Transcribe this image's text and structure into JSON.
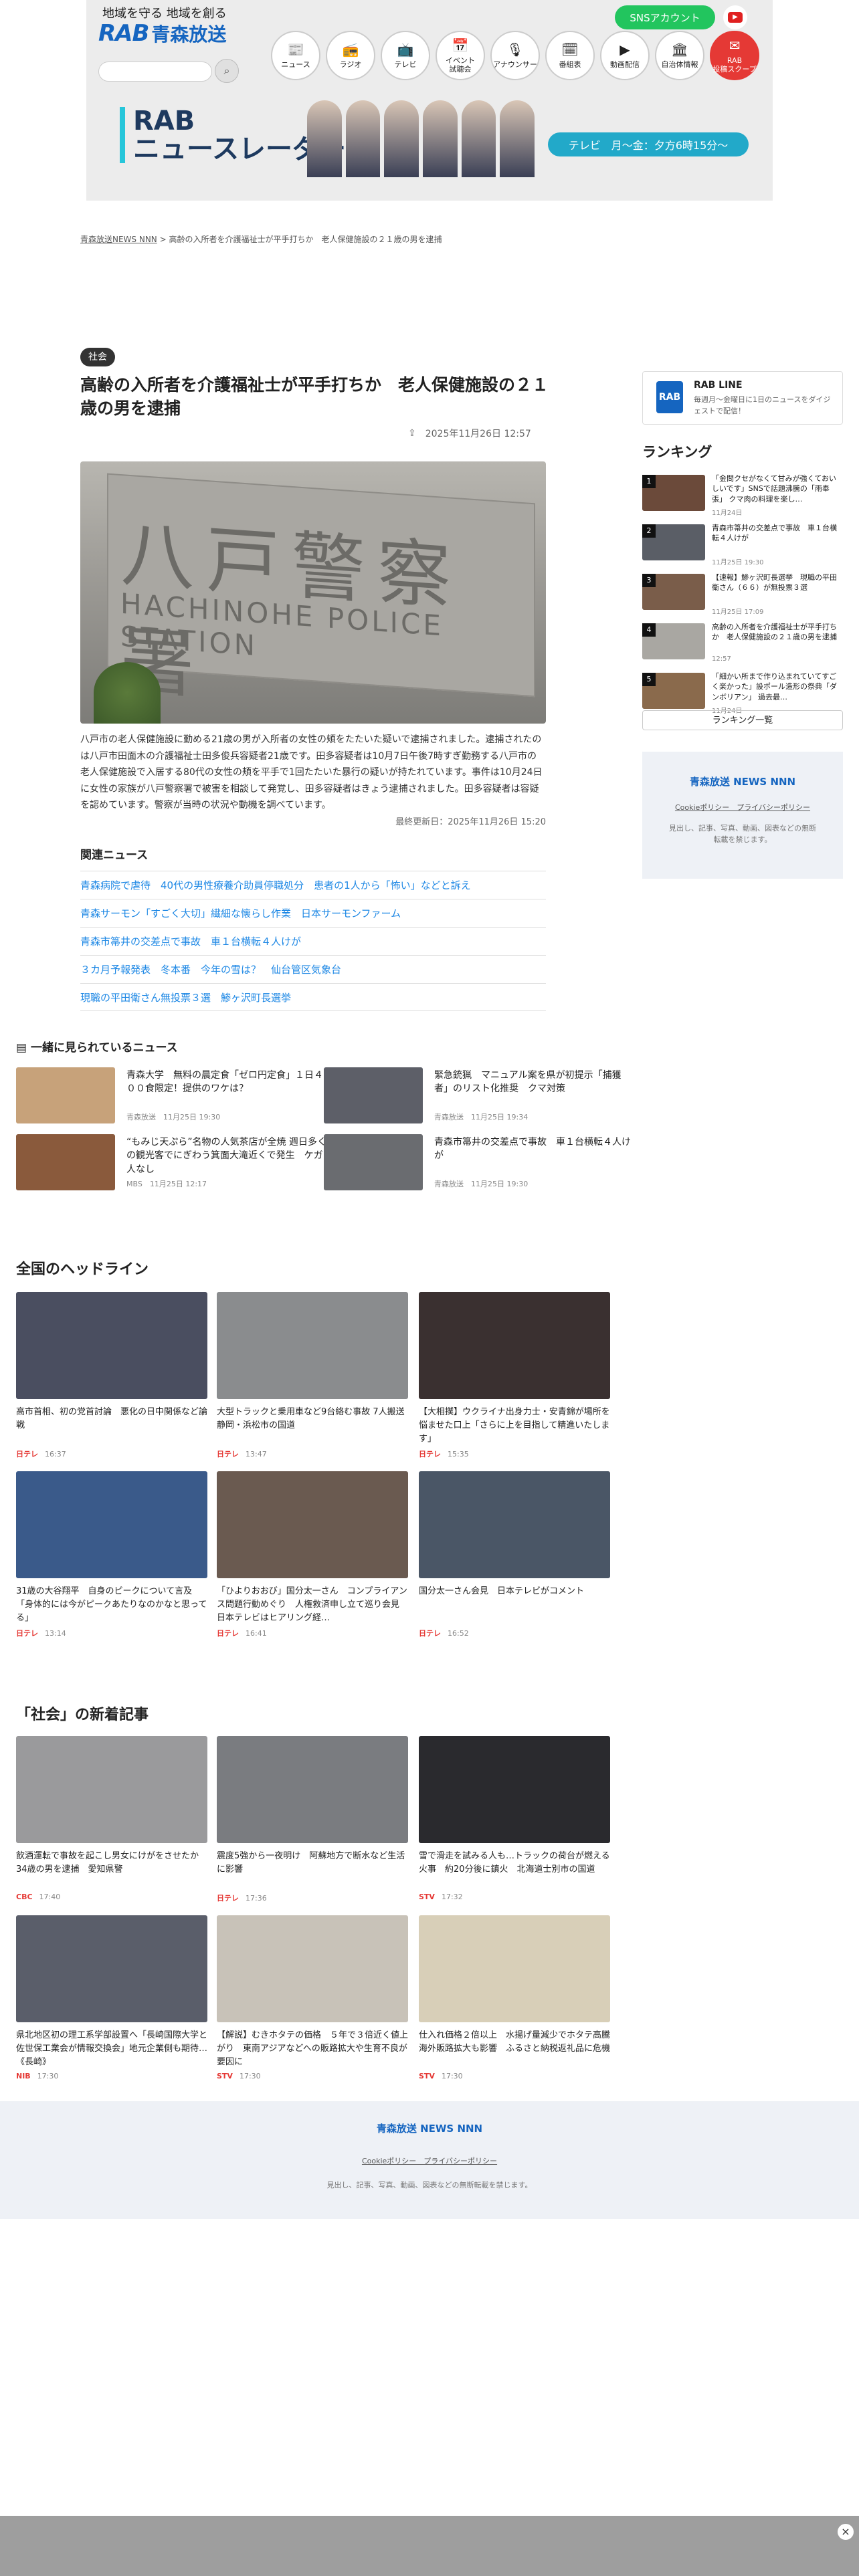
{
  "header": {
    "tagline": "地域を守る 地域を創る",
    "logo_latin": "RAB",
    "logo_kanji": "青森放送",
    "sns_label": "SNSアカウント",
    "youtube_icon": "youtube-icon",
    "nav": [
      {
        "icon": "📰",
        "label": "ニュース"
      },
      {
        "icon": "📻",
        "label": "ラジオ"
      },
      {
        "icon": "📺",
        "label": "テレビ"
      },
      {
        "icon": "📅",
        "label": "イベント\n試聴会"
      },
      {
        "icon": "🎙",
        "label": "アナウンサー"
      },
      {
        "icon": "🗓",
        "label": "番組表"
      },
      {
        "icon": "▶",
        "label": "動画配信"
      },
      {
        "icon": "🏛",
        "label": "自治体情報"
      },
      {
        "icon": "✉",
        "label": "RAB\n投稿スクープ"
      }
    ],
    "banner_title": "RAB\nニュースレーダー",
    "banner_schedule": "テレビ　月〜金：夕方6時15分〜"
  },
  "breadcrumb": {
    "root": "青森放送NEWS NNN",
    "sep": ">",
    "current": "高齢の入所者を介護福祉士が平手打ちか　老人保健施設の２１歳の男を逮捕"
  },
  "article": {
    "category": "社会",
    "title": "高齢の入所者を介護福祉士が平手打ちか　老人保健施設の２１歳の男を逮捕",
    "date": "2025年11月26日 12:57",
    "photo_text_ja": "八戸警察署",
    "photo_text_en": "HACHINOHE POLICE STATION",
    "body": "八戸市の老人保健施設に勤める21歳の男が入所者の女性の頬をたたいた疑いで逮捕されました。逮捕されたのは八戸市田面木の介護福祉士田多俊兵容疑者21歳です。田多容疑者は10月7日午後7時すぎ勤務する八戸市の老人保健施設で入居する80代の女性の頬を平手で1回たたいた暴行の疑いが持たれています。事件は10月24日に女性の家族が八戸警察署で被害を相談して発覚し、田多容疑者はきょう逮捕されました。田多容疑者は容疑を認めています。警察が当時の状況や動機を調べています。",
    "updated": "最終更新日：2025年11月26日 15:20",
    "related_heading": "関連ニュース",
    "related": [
      "青森病院で虐待　40代の男性療養介助員停職処分　患者の1人から「怖い」などと訴え",
      "青森サーモン「すごく大切」繊細な懐らし作業　日本サーモンファーム",
      "青森市箒井の交差点で事故　車１台横転４人けが",
      "３カ月予報発表　冬本番　今年の雪は？　仙台管区気象台",
      "現職の平田衛さん無投票３選　鯵ヶ沢町長選挙"
    ]
  },
  "sidebar": {
    "line_logo": "RAB",
    "line_title": "RAB LINE",
    "line_desc": "毎週月〜金曜日に1日のニュースをダイジェストで配信！",
    "ranking_heading": "ランキング",
    "ranking": [
      {
        "n": "1",
        "title": "「金問クセがなくて甘みが強くておいしいです」SNSで話題沸騰の「雨奉張」 クマ肉の料理を楽し…",
        "date": "11月24日"
      },
      {
        "n": "2",
        "title": "青森市箒井の交差点で事故　車１台横転４人けが",
        "date": "11月25日 19:30"
      },
      {
        "n": "3",
        "title": "【速報】鯵ヶ沢町長選挙　現職の平田衛さん（６６）が無投票３選",
        "date": "11月25日 17:09"
      },
      {
        "n": "4",
        "title": "高齢の入所者を介護福祉士が平手打ちか　老人保健施設の２１歳の男を逮捕",
        "date": "12:57"
      },
      {
        "n": "5",
        "title": "「細かい所まで作り込まれていてすごく楽かった」設ポール造形の祭典「ダンボリアン」 過去最…",
        "date": "11月24日"
      }
    ],
    "ranking_more": "ランキング一覧",
    "footer_logo": "青森放送 NEWS NNN",
    "footer_links": "Cookieポリシー　プライバシーポリシー",
    "footer_copy": "見出し、記事、写真、動画、図表などの無断転載を禁じます。"
  },
  "recommended": {
    "heading": "一緒に見られているニュース",
    "items": [
      {
        "title": "青森大学　無料の晨定食「ゼロ円定食」１日４００食限定！提供のワケは？",
        "src": "青森放送",
        "date": "11月25日 19:30"
      },
      {
        "title": "緊急銃猟　マニュアル案を県が初提示「捕獲者」のリスト化推奨　クマ対策",
        "src": "青森放送",
        "date": "11月25日 19:34"
      },
      {
        "title": "“もみじ天ぷら”名物の人気茶店が全焼 週日多くの観光客でにぎわう箕面大滝近くで発生　ケガ人なし",
        "src": "MBS",
        "date": "11月25日 12:17"
      },
      {
        "title": "青森市箒井の交差点で事故　車１台横転４人けが",
        "src": "青森放送",
        "date": "11月25日 19:30"
      }
    ]
  },
  "national": {
    "heading": "全国のヘッドライン",
    "items": [
      {
        "title": "高市首相、初の党首討論　悪化の日中関係など論戦",
        "src": "日テレ",
        "time": "16:37"
      },
      {
        "title": "大型トラックと乗用車など9台絡む事故 7人搬送　静岡・浜松市の国道",
        "src": "日テレ",
        "time": "13:47"
      },
      {
        "title": "【大相撲】ウクライナ出身力士・安青錦が場所を悩ませた口上「さらに上を目指して精進いたします」",
        "src": "日テレ",
        "time": "15:35"
      },
      {
        "title": "31歳の大谷翔平　自身のピークについて言及「身体的には今がピークあたりなのかなと思ってる」",
        "src": "日テレ",
        "time": "13:14"
      },
      {
        "title": "「ひよりおおび」国分太一さん　コンプライアンス問題行動めぐり　人権救済申し立て巡り会見　日本テレビはヒアリング経…",
        "src": "日テレ",
        "time": "16:41"
      },
      {
        "title": "国分太一さん会見　日本テレビがコメント",
        "src": "日テレ",
        "time": "16:52"
      }
    ]
  },
  "social": {
    "heading": "「社会」の新着記事",
    "items": [
      {
        "title": "飲酒運転で事故を起こし男女にけがをさせたか　34歳の男を逮捕　愛知県警",
        "src": "CBC",
        "time": "17:40"
      },
      {
        "title": "震度5強から一夜明け　阿蘇地方で断水など生活に影響",
        "src": "日テレ",
        "time": "17:36"
      },
      {
        "title": "雪で滑走を試みる人も…トラックの荷台が燃える火事　約20分後に鎮火　北海道士別市の国道",
        "src": "STV",
        "time": "17:32"
      },
      {
        "title": "県北地区初の理工系学部設置へ「長崎国際大学と佐世保工業会が情報交換会」地元企業側も期待…《長崎》",
        "src": "NIB",
        "time": "17:30"
      },
      {
        "title": "【解説】むきホタテの価格　５年で３倍近く値上がり　東南アジアなどへの販路拡大や生育不良が要因に",
        "src": "STV",
        "time": "17:30"
      },
      {
        "title": "仕入れ価格２倍以上　水揚げ量減少でホタテ高騰　海外販路拡大も影響　ふるさと納税返礼品に危機",
        "src": "STV",
        "time": "17:30"
      }
    ]
  },
  "footer": {
    "logo": "青森放送 NEWS NNN",
    "links": "Cookieポリシー　プライバシーポリシー",
    "copy": "見出し、記事、写真、動画、図表などの無断転載を禁じます。"
  },
  "ad": {
    "close": "×"
  }
}
